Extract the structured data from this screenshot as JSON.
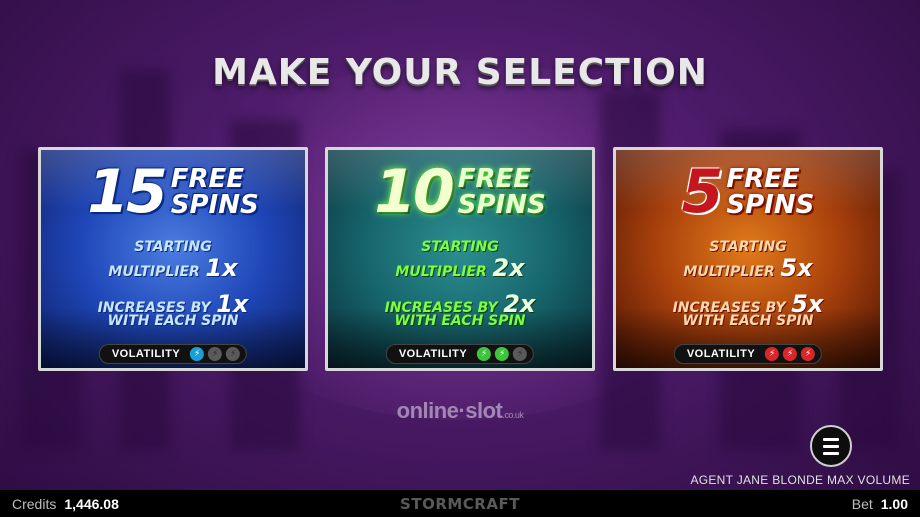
{
  "title": "MAKE YOUR SELECTION",
  "cards": [
    {
      "spins_number": "15",
      "spins_word1": "FREE",
      "spins_word2": "SPINS",
      "line1_small": "STARTING",
      "line2_small": "MULTIPLIER",
      "line2_big": "1x",
      "line3_small": "INCREASES BY",
      "line3_big": "1x",
      "line4_small": "WITH EACH SPIN",
      "volatility_label": "VOLATILITY",
      "volatility_level": 1,
      "volatility_max": 3,
      "accent_color": "#1aa0d8"
    },
    {
      "spins_number": "10",
      "spins_word1": "FREE",
      "spins_word2": "SPINS",
      "line1_small": "STARTING",
      "line2_small": "MULTIPLIER",
      "line2_big": "2x",
      "line3_small": "INCREASES BY",
      "line3_big": "2x",
      "line4_small": "WITH EACH SPIN",
      "volatility_label": "VOLATILITY",
      "volatility_level": 2,
      "volatility_max": 3,
      "accent_color": "#3cc43c"
    },
    {
      "spins_number": "5",
      "spins_word1": "FREE",
      "spins_word2": "SPINS",
      "line1_small": "STARTING",
      "line2_small": "MULTIPLIER",
      "line2_big": "5x",
      "line3_small": "INCREASES BY",
      "line3_big": "5x",
      "line4_small": "WITH EACH SPIN",
      "volatility_label": "VOLATILITY",
      "volatility_level": 3,
      "volatility_max": 3,
      "accent_color": "#d8262a"
    }
  ],
  "watermark": {
    "main": "online·slot",
    "suffix": ".co.uk"
  },
  "menu_icon": "hamburger-menu-icon",
  "game_name": "AGENT JANE BLONDE MAX VOLUME",
  "footer": {
    "credits_label": "Credits",
    "credits_value": "1,446.08",
    "brand": "STORMCRAFT",
    "bet_label": "Bet",
    "bet_value": "1.00"
  }
}
